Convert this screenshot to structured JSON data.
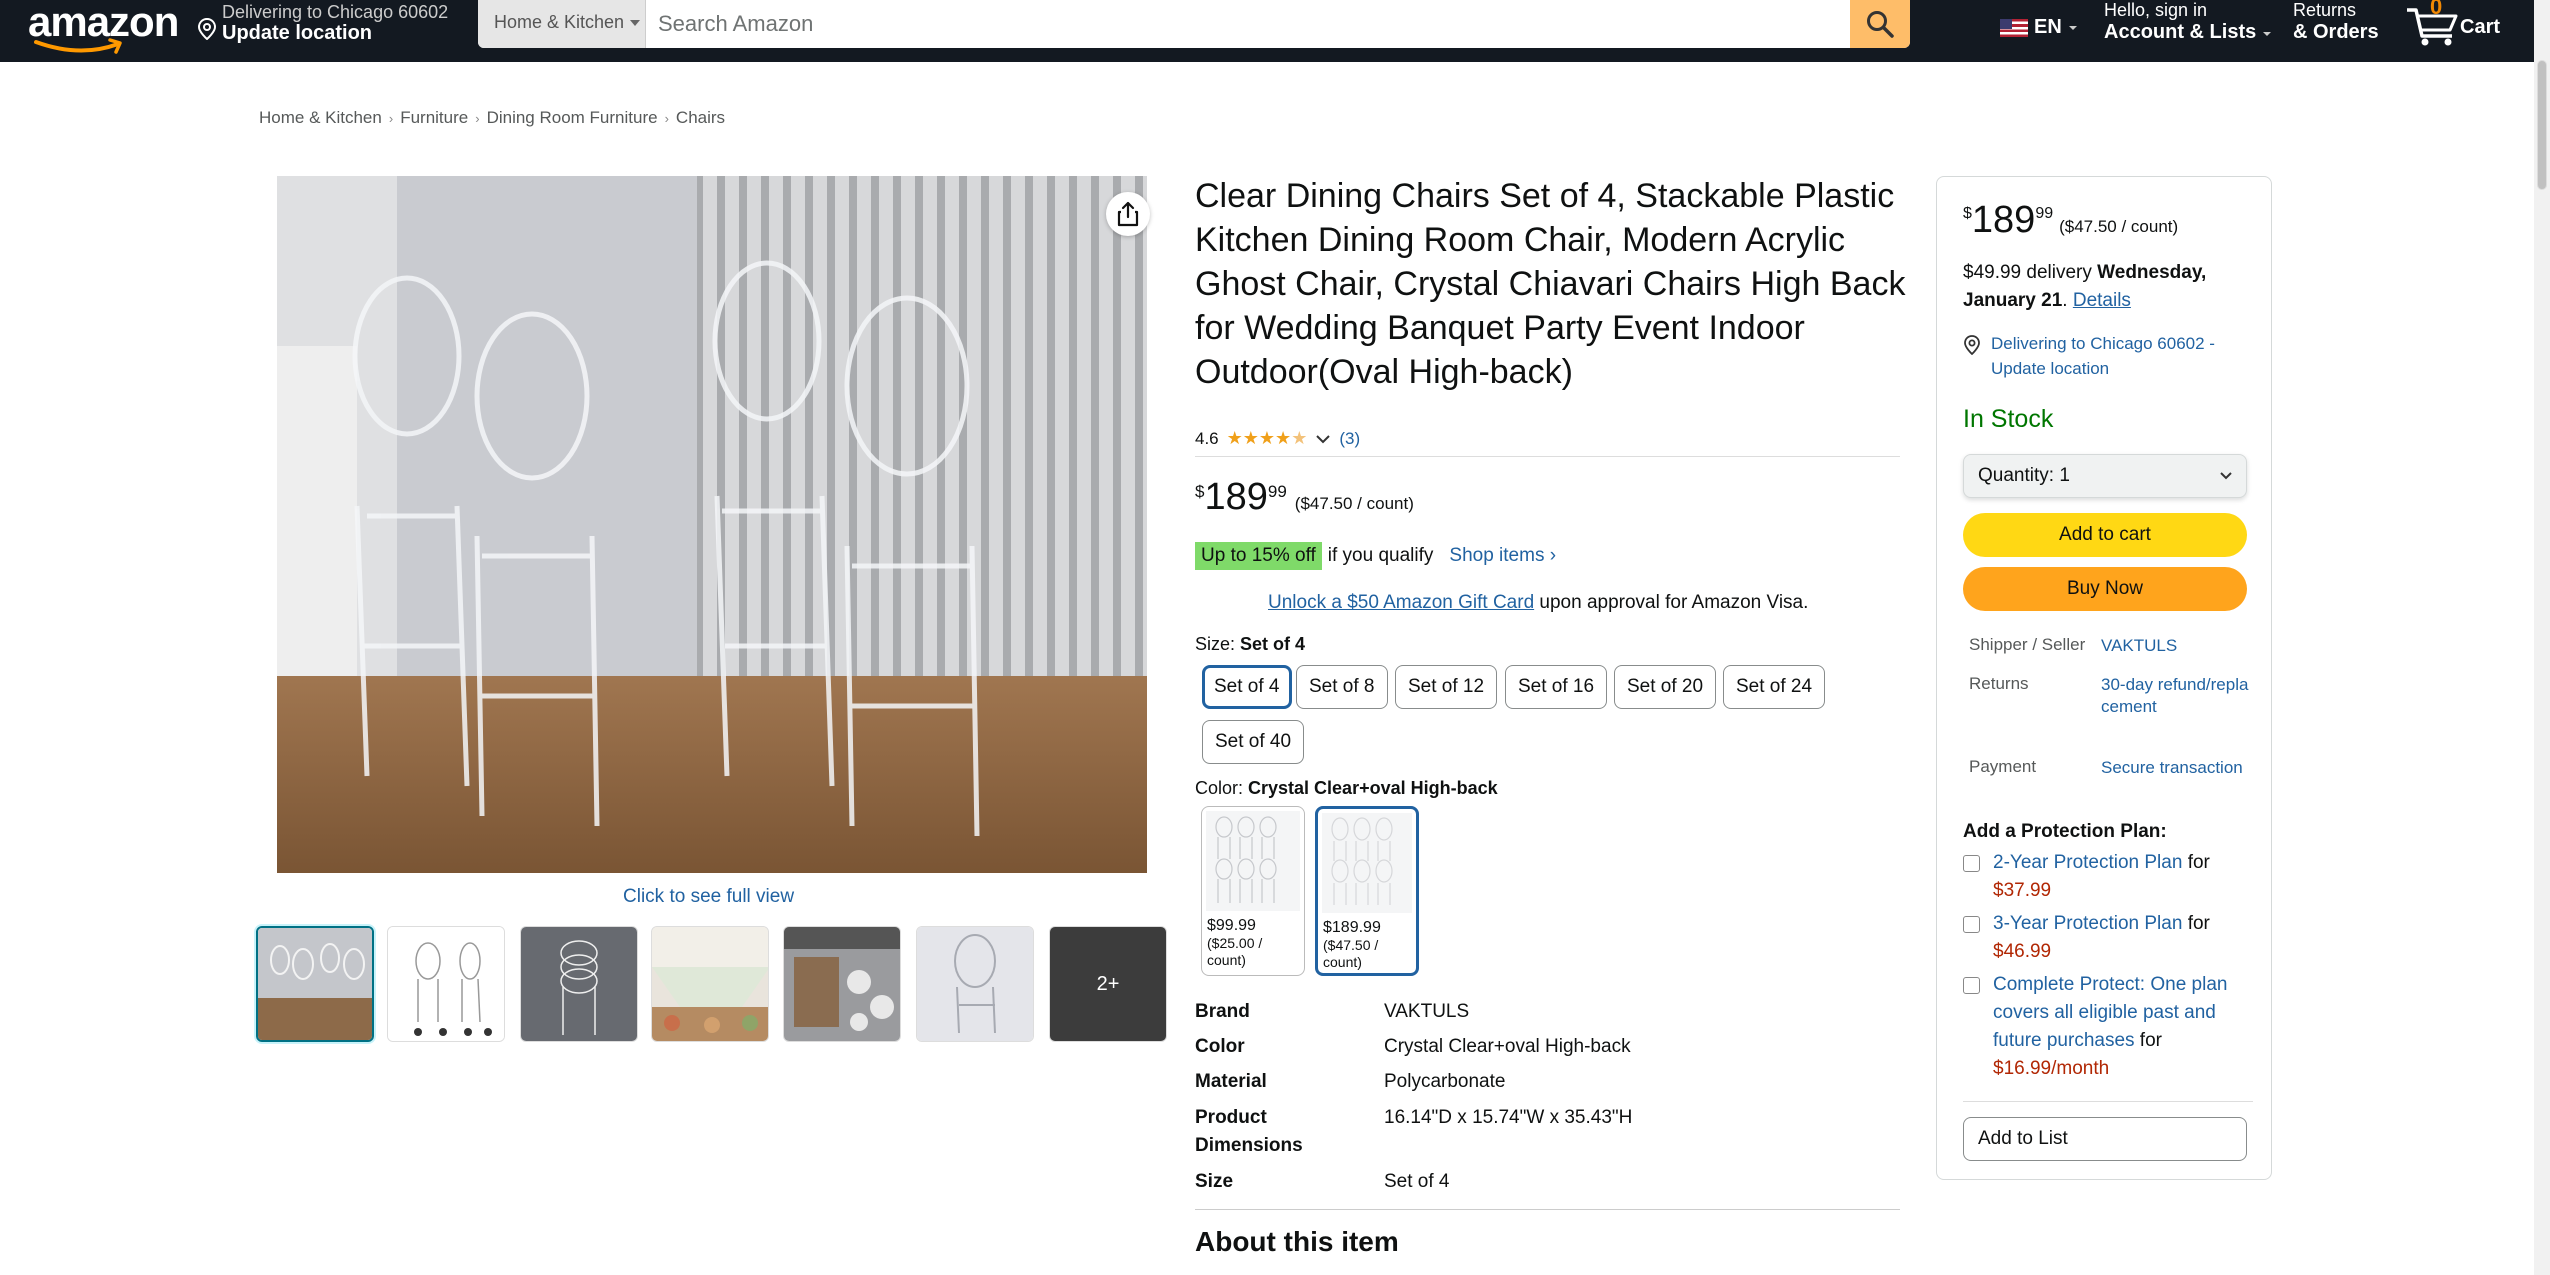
{
  "header": {
    "logo": "amazon",
    "deliver_line1": "Delivering to Chicago 60602",
    "deliver_line2": "Update location",
    "search_category": "Home & Kitchen",
    "search_placeholder": "Search Amazon",
    "language": "EN",
    "account_line1": "Hello, sign in",
    "account_line2": "Account & Lists",
    "orders_line1": "Returns",
    "orders_line2": "& Orders",
    "cart_count": "0",
    "cart_label": "Cart"
  },
  "breadcrumb": [
    "Home & Kitchen",
    "Furniture",
    "Dining Room Furniture",
    "Chairs"
  ],
  "gallery": {
    "full_view": "Click to see full view",
    "more_label": "2+"
  },
  "product": {
    "title": "Clear Dining Chairs Set of 4, Stackable Plastic Kitchen Dining Room Chair, Modern Acrylic Ghost Chair, Crystal Chiavari Chairs High Back for Wedding Banquet Party Event Indoor Outdoor(Oval High-back)",
    "rating_value": "4.6",
    "rating_count": "(3)",
    "price_symbol": "$",
    "price_whole": "189",
    "price_fraction": "99",
    "price_unit": "($47.50 / count)",
    "promo_badge": "Up to 15% off",
    "promo_text": "if you qualify",
    "promo_link": "Shop items ›",
    "giftcard_link": "Unlock a $50 Amazon Gift Card",
    "giftcard_text": " upon approval for Amazon Visa.",
    "size_label": "Size: ",
    "size_selected": "Set of 4",
    "sizes": [
      "Set of 4",
      "Set of 8",
      "Set of 12",
      "Set of 16",
      "Set of 20",
      "Set of 24",
      "Set of 40"
    ],
    "color_label": "Color: ",
    "color_selected": "Crystal Clear+oval High-back",
    "swatches": [
      {
        "price": "$99.99",
        "unit": "($25.00 / count)"
      },
      {
        "price": "$189.99",
        "unit": "($47.50 / count)"
      }
    ],
    "specs": [
      {
        "k": "Brand",
        "v": "VAKTULS"
      },
      {
        "k": "Color",
        "v": "Crystal Clear+oval High-back"
      },
      {
        "k": "Material",
        "v": "Polycarbonate"
      },
      {
        "k": "Product Dimensions",
        "v": "16.14\"D x 15.74\"W x 35.43\"H"
      },
      {
        "k": "Size",
        "v": "Set of 4"
      }
    ],
    "about_heading": "About this item"
  },
  "buybox": {
    "price_symbol": "$",
    "price_whole": "189",
    "price_fraction": "99",
    "price_unit": "($47.50 / count)",
    "delivery_prefix": "$49.99 delivery ",
    "delivery_date": "Wednesday, January 21",
    "delivery_link": "Details",
    "location": "Delivering to Chicago 60602 - Update location",
    "stock": "In Stock",
    "quantity": "Quantity:  1",
    "add_to_cart": "Add to cart",
    "buy_now": "Buy Now",
    "shipper_k": "Shipper / Seller",
    "shipper_v": "VAKTULS",
    "returns_k": "Returns",
    "returns_v": "30-day refund/replacement",
    "payment_k": "Payment",
    "payment_v": "Secure transaction",
    "protection_heading": "Add a Protection Plan:",
    "plans": [
      {
        "name": "2-Year Protection Plan",
        "for": " for ",
        "price": "$37.99"
      },
      {
        "name": "3-Year Protection Plan",
        "for": " for ",
        "price": "$46.99"
      },
      {
        "name": "Complete Protect: One plan covers all eligible past and future purchases",
        "for": " for ",
        "price": "$16.99/month"
      }
    ],
    "add_to_list": "Add to List"
  },
  "colors": {
    "nav_bg": "#131921",
    "search_btn": "#febd69",
    "add_to_cart": "#ffd814",
    "buy_now": "#ffa41c",
    "in_stock": "#007600",
    "link": "#2162a1",
    "price_red": "#b12704",
    "promo_green": "#7fda69"
  }
}
